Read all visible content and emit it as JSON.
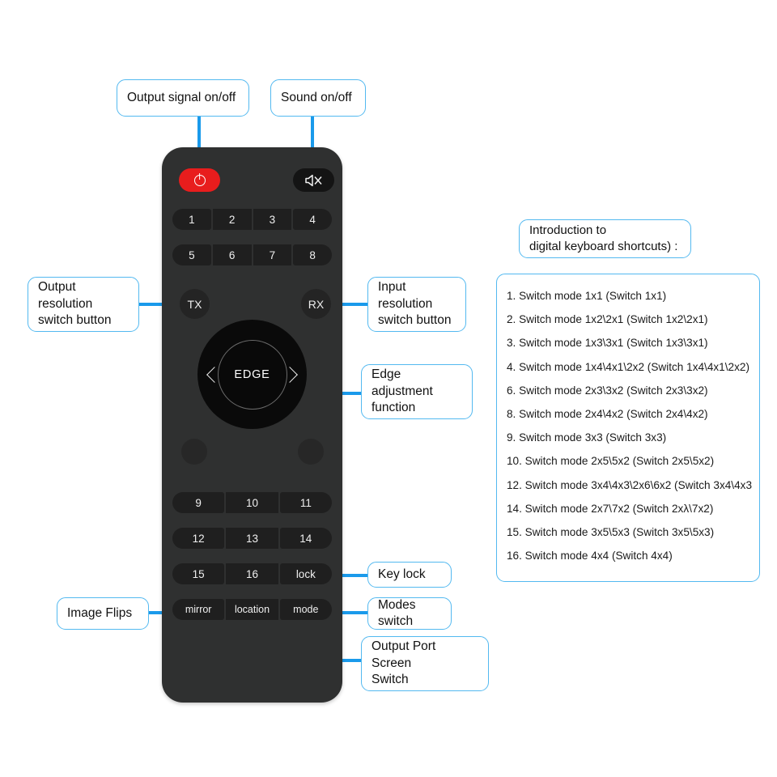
{
  "callouts": {
    "power": "Output signal on/off",
    "mute": "Sound on/off",
    "tx": "Output resolution\nswitch button",
    "tx_line1": "Output resolution",
    "tx_line2": "switch button",
    "rx_line1": "Input resolution",
    "rx_line2": "switch button",
    "edge_line1": "Edge adjustment",
    "edge_line2": "function",
    "lock": "Key lock",
    "mirror": "Image Flips",
    "mode": "Modes switch",
    "location_line1": "Output Port Screen",
    "location_line2": "Switch"
  },
  "remote": {
    "power_icon": "power-icon",
    "mute_icon": "mute-speaker-icon",
    "keypad_row1": [
      "1",
      "2",
      "3",
      "4"
    ],
    "keypad_row2": [
      "5",
      "6",
      "7",
      "8"
    ],
    "tx_label": "TX",
    "rx_label": "RX",
    "edge_label": "EDGE",
    "chevron_left": "chevron-left-icon",
    "chevron_right": "chevron-right-icon",
    "keypad_row3": [
      "9",
      "10",
      "11"
    ],
    "keypad_row4": [
      "12",
      "13",
      "14"
    ],
    "keypad_row5": [
      "15",
      "16",
      "lock"
    ],
    "keypad_row6": [
      "mirror",
      "location",
      "mode"
    ]
  },
  "shortcuts": {
    "header_line1": "Introduction to",
    "header_line2": "digital keyboard shortcuts) :",
    "items": [
      "1. Switch mode 1x1 (Switch 1x1)",
      "2. Switch mode 1x2\\2x1 (Switch 1x2\\2x1)",
      "3. Switch mode 1x3\\3x1 (Switch 1x3\\3x1)",
      "4. Switch mode 1x4\\4x1\\2x2 (Switch 1x4\\4x1\\2x2)",
      "6. Switch mode 2x3\\3x2 (Switch 2x3\\3x2)",
      "8. Switch mode 2x4\\4x2 (Switch 2x4\\4x2)",
      "9. Switch mode 3x3 (Switch 3x3)",
      "10. Switch mode 2x5\\5x2 (Switch 2x5\\5x2)",
      "12. Switch mode 3x4\\4x3\\2x6\\6x2 (Switch 3x4\\4x3",
      "14. Switch mode 2x7\\7x2 (Switch 2xλ\\7x2)",
      "15. Switch mode 3x5\\5x3 (Switch 3x5\\5x3)",
      "16. Switch mode 4x4 (Switch 4x4)"
    ]
  },
  "colors": {
    "accent": "#1a9aeb",
    "callout_border": "#53b9f0",
    "remote_body": "#2f3030",
    "button": "#1f1f1f",
    "power_red": "#e81d1d",
    "background": "#ffffff"
  }
}
